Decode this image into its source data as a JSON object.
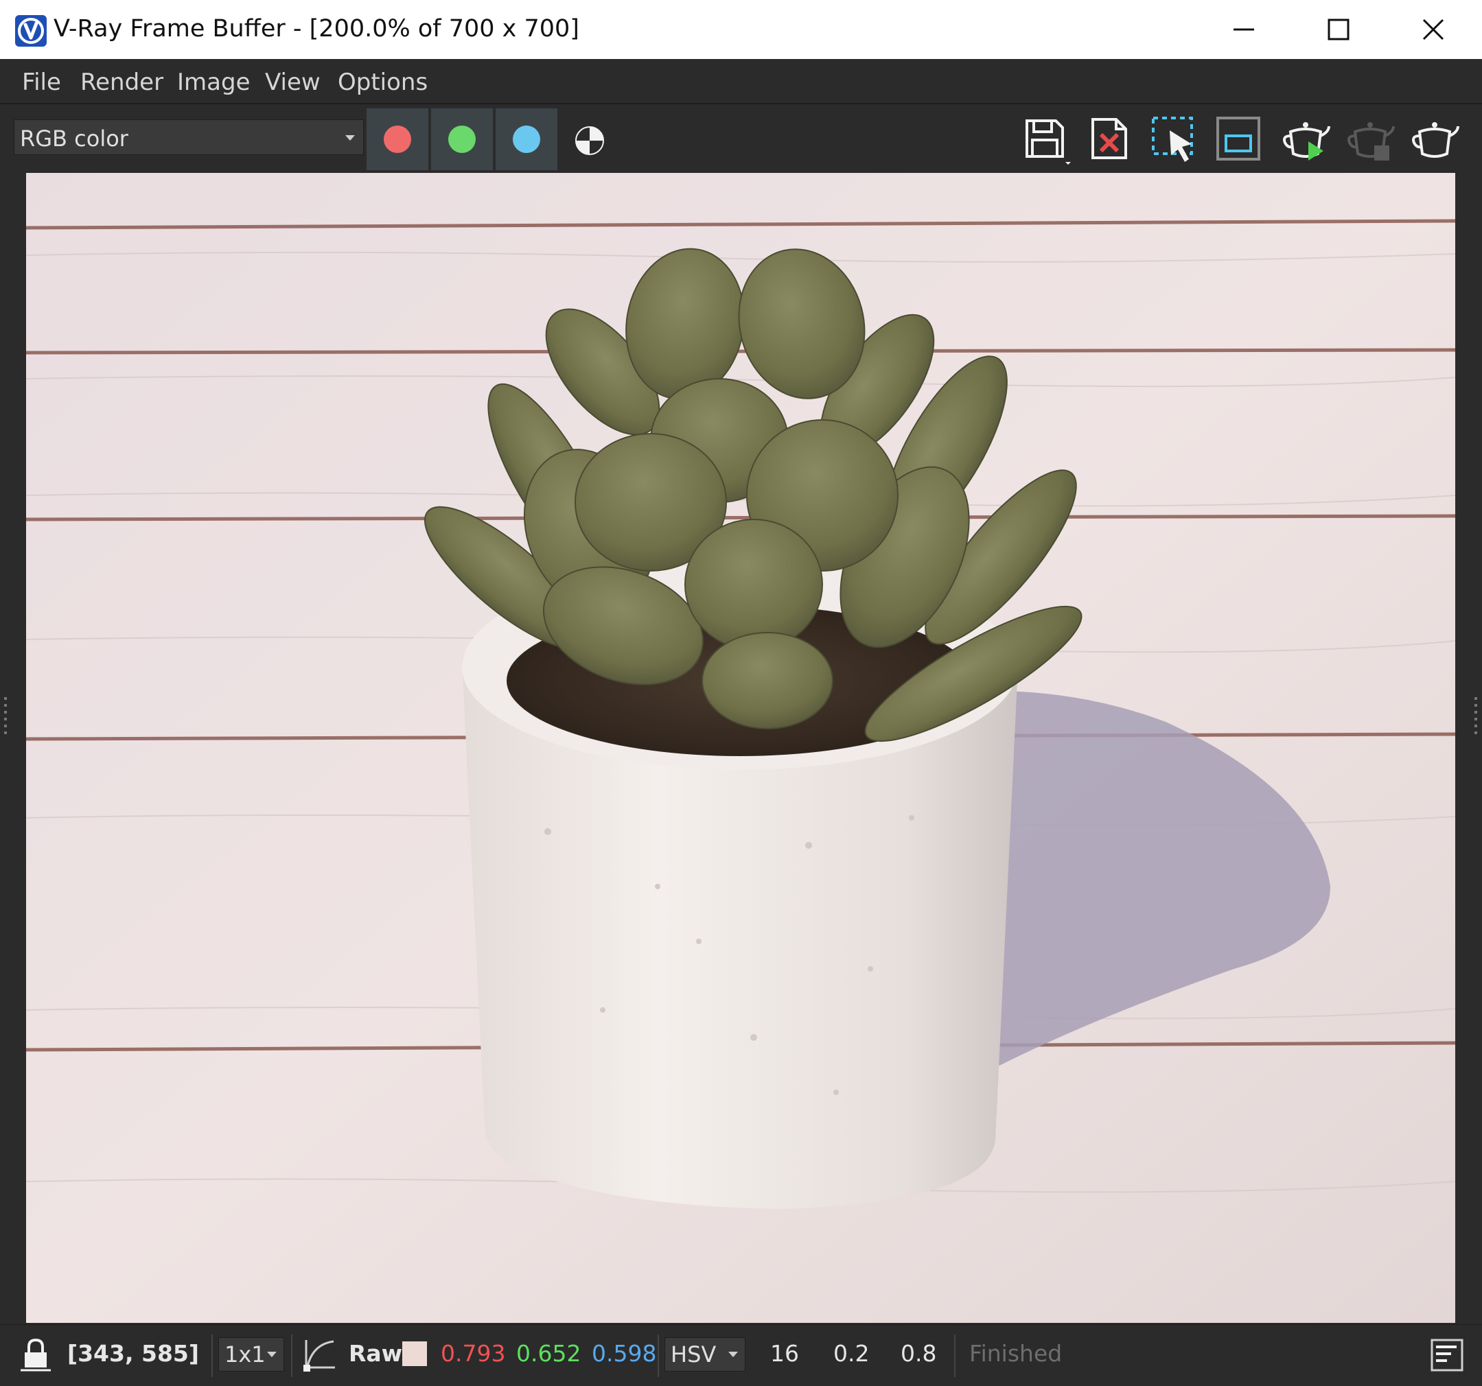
{
  "window": {
    "title": "V-Ray Frame Buffer - [200.0% of 700 x 700]",
    "logo_icon": "vray-logo-icon",
    "controls": [
      "minimize-icon",
      "maximize-icon",
      "close-icon"
    ]
  },
  "menu": {
    "items": [
      "File",
      "Render",
      "Image",
      "View",
      "Options"
    ]
  },
  "toolbar": {
    "channel": "RGB color",
    "channel_buttons": [
      {
        "icon": "red-channel-icon",
        "color": "#f06a6a"
      },
      {
        "icon": "green-channel-icon",
        "color": "#6ad86a"
      },
      {
        "icon": "blue-channel-icon",
        "color": "#6ac8f0"
      }
    ],
    "mono_icon": "monochrome-icon",
    "right_icons": [
      "save-image-icon",
      "clear-image-icon",
      "region-render-icon",
      "track-mouse-icon",
      "interactive-render-icon",
      "stop-render-icon",
      "render-teapot-icon"
    ]
  },
  "viewport": {
    "image_subject": "potted-succulent-render"
  },
  "status": {
    "lock_icon": "lock-icon",
    "coords": "[343, 585]",
    "sample_size": "1x1",
    "curve_icon": "curve-icon",
    "color_mode": "Raw",
    "swatch_color": "#eedad4",
    "r": "0.793",
    "g": "0.652",
    "b": "0.598",
    "r_color": "#f25252",
    "g_color": "#5ee05e",
    "b_color": "#58aaf0",
    "color_space": "HSV",
    "h": "16",
    "s": "0.2",
    "v": "0.8",
    "state": "Finished",
    "history_icon": "history-panel-icon"
  }
}
